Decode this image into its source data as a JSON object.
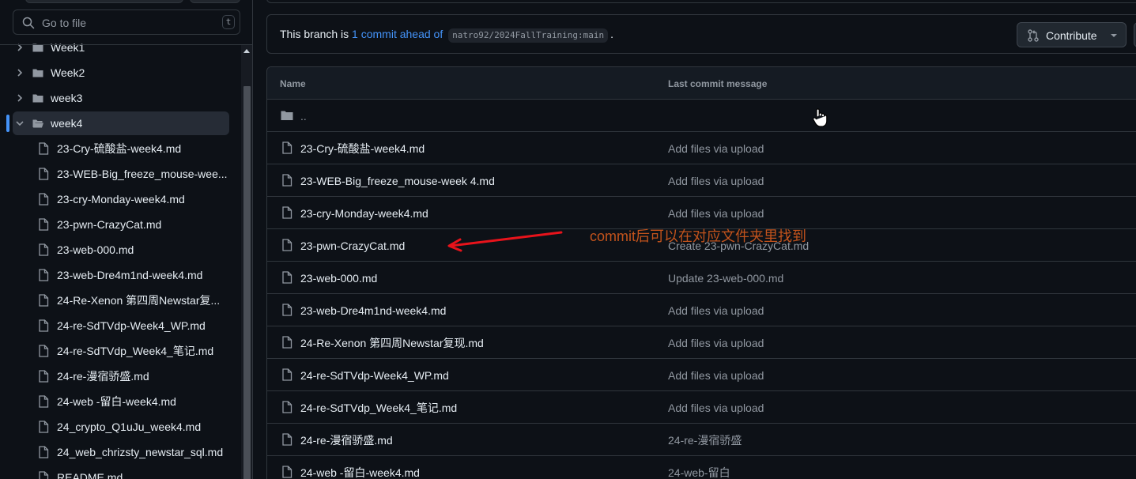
{
  "sidebar": {
    "search": {
      "placeholder": "Go to file",
      "shortcut": "t"
    },
    "folders": [
      {
        "label": "Week1",
        "expanded": false
      },
      {
        "label": "Week2",
        "expanded": false
      },
      {
        "label": "week3",
        "expanded": false
      },
      {
        "label": "week4",
        "expanded": true,
        "selected": true
      }
    ],
    "files": [
      "23-Cry-硫酸盐-week4.md",
      "23-WEB-Big_freeze_mouse-wee...",
      "23-cry-Monday-week4.md",
      "23-pwn-CrazyCat.md",
      "23-web-000.md",
      "23-web-Dre4m1nd-week4.md",
      "24-Re-Xenon 第四周Newstar复...",
      "24-re-SdTVdp-Week4_WP.md",
      "24-re-SdTVdp_Week4_笔记.md",
      "24-re-漫宿骄盛.md",
      "24-web -留白-week4.md",
      "24_crypto_Q1uJu_week4.md",
      "24_web_chrizsty_newstar_sql.md",
      "README.md"
    ]
  },
  "branch": {
    "prefix": "This branch is",
    "link": "1 commit ahead of",
    "ref": "natro92/2024FallTraining:main",
    "suffix": ".",
    "contribute_label": "Contribute"
  },
  "table": {
    "headers": {
      "name": "Name",
      "message": "Last commit message"
    },
    "parent_dir": "..",
    "rows": [
      {
        "name": "23-Cry-硫酸盐-week4.md",
        "message": "Add files via upload"
      },
      {
        "name": "23-WEB-Big_freeze_mouse-week 4.md",
        "message": "Add files via upload"
      },
      {
        "name": "23-cry-Monday-week4.md",
        "message": "Add files via upload"
      },
      {
        "name": "23-pwn-CrazyCat.md",
        "message": "Create 23-pwn-CrazyCat.md"
      },
      {
        "name": "23-web-000.md",
        "message": "Update 23-web-000.md"
      },
      {
        "name": "23-web-Dre4m1nd-week4.md",
        "message": "Add files via upload"
      },
      {
        "name": "24-Re-Xenon 第四周Newstar复现.md",
        "message": "Add files via upload"
      },
      {
        "name": "24-re-SdTVdp-Week4_WP.md",
        "message": "Add files via upload"
      },
      {
        "name": "24-re-SdTVdp_Week4_笔记.md",
        "message": "Add files via upload"
      },
      {
        "name": "24-re-漫宿骄盛.md",
        "message": "24-re-漫宿骄盛"
      },
      {
        "name": "24-web -留白-week4.md",
        "message": "24-web-留白"
      }
    ]
  },
  "annotation": {
    "text": "commit后可以在对应文件夹里找到",
    "color": "#c2531c",
    "arrow_color": "#e8131b"
  },
  "colors": {
    "background": "#0d1117",
    "border": "#30363d",
    "link": "#4493f8",
    "muted": "#9198a1",
    "selected_bar": "#4493f8"
  }
}
